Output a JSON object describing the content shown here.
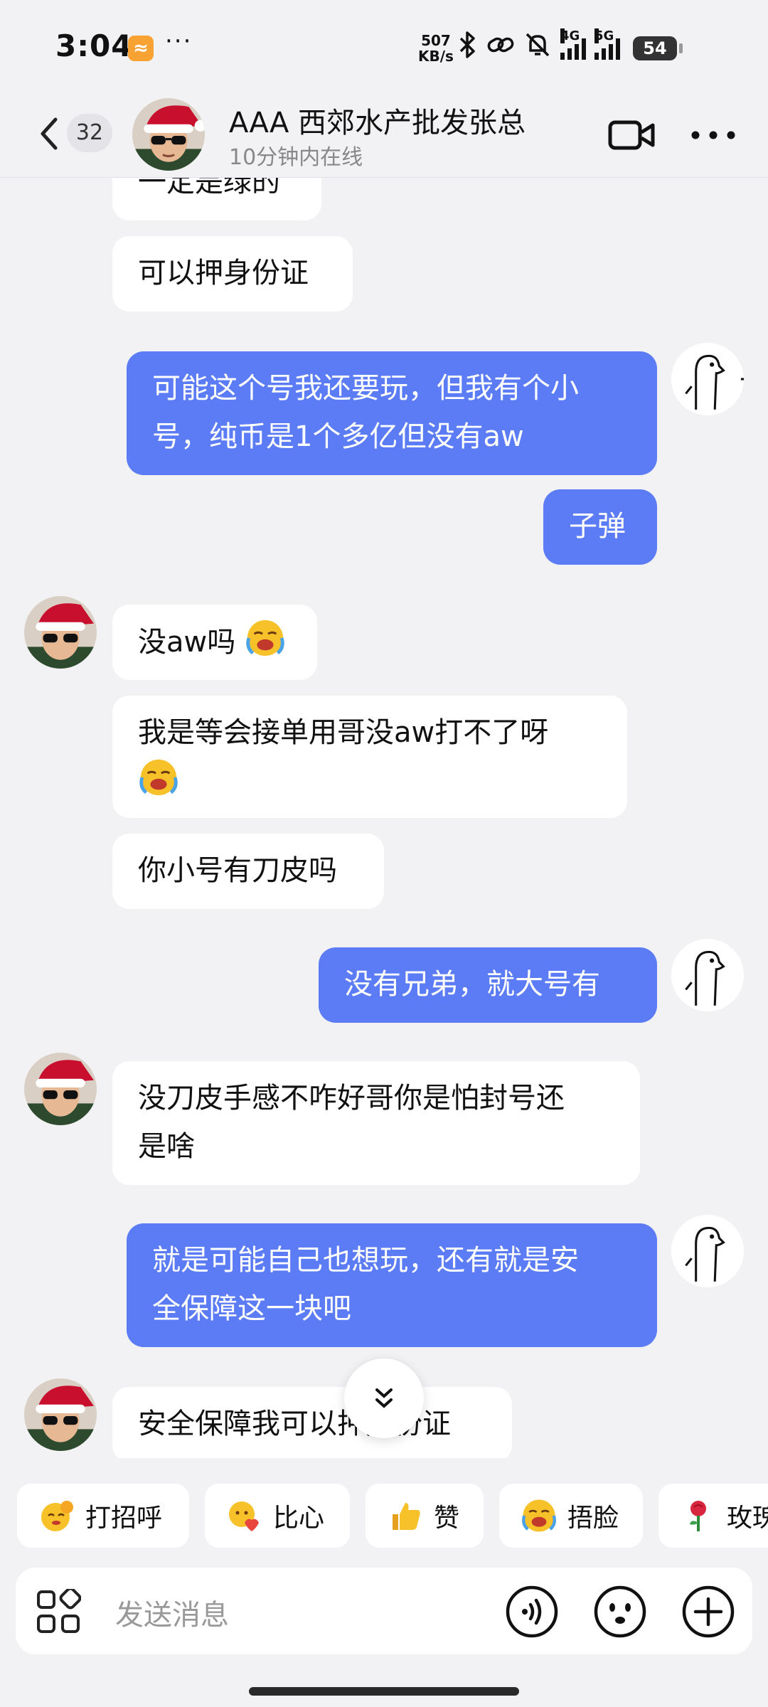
{
  "status_bar": {
    "time": "3:04",
    "app_icon": "orange-app-icon",
    "more": "···",
    "net_speed_value": "507",
    "net_speed_unit": "KB/s",
    "sig1": "4G",
    "sig2": "5G",
    "battery": "54"
  },
  "header": {
    "unread_count": "32",
    "contact_name": "AAA 西郊水产批发张总",
    "contact_status": "10分钟内在线"
  },
  "messages": [
    {
      "side": "in",
      "text": "一定是绿的"
    },
    {
      "side": "in",
      "text": "可以押身份证"
    },
    {
      "side": "out",
      "line1": "可能这个号我还要玩，但我有个小",
      "line2": "号，纯币是1个多亿但没有aw"
    },
    {
      "side": "out",
      "text": "子弹"
    },
    {
      "side": "in",
      "text": "没aw吗"
    },
    {
      "side": "in",
      "text": "我是等会接单用哥没aw打不了呀"
    },
    {
      "side": "in",
      "text": "你小号有刀皮吗"
    },
    {
      "side": "out",
      "text": "没有兄弟，就大号有"
    },
    {
      "side": "in",
      "line1": "没刀皮手感不咋好哥你是怕封号还",
      "line2": "是啥"
    },
    {
      "side": "out",
      "line1": "就是可能自己也想玩，还有就是安",
      "line2": "全保障这一块吧"
    },
    {
      "side": "in",
      "text": "安全保障我可以押身份证"
    }
  ],
  "quick_replies": [
    "打招呼",
    "比心",
    "赞",
    "捂脸",
    "玫瑰"
  ],
  "input": {
    "placeholder": "发送消息"
  },
  "colors": {
    "outgoing_bubble": "#5b7cf5",
    "incoming_bubble": "#ffffff",
    "background": "#f2f2f4"
  }
}
